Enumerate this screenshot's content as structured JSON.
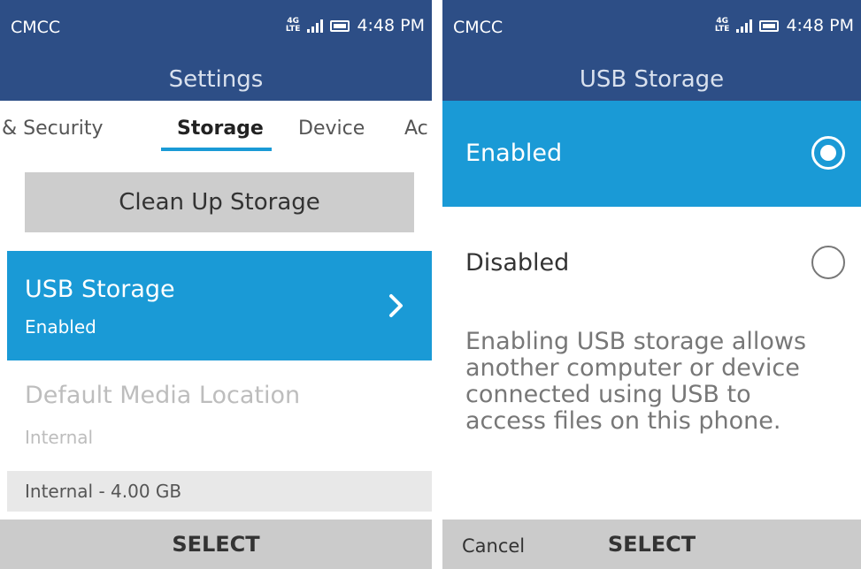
{
  "status": {
    "carrier": "CMCC",
    "network_top": "4G",
    "network_bottom": "LTE",
    "time": "4:48 PM"
  },
  "left": {
    "title": "Settings",
    "tabs": [
      "y & Security",
      "Storage",
      "Device",
      "Ac"
    ],
    "active_tab": "Storage",
    "clean_button": "Clean Up Storage",
    "usb": {
      "title": "USB Storage",
      "value": "Enabled"
    },
    "media": {
      "title": "Default Media Location",
      "value": "Internal"
    },
    "storage_info": "Internal - 4.00 GB",
    "softkey_center": "SELECT"
  },
  "right": {
    "title": "USB Storage",
    "options": [
      {
        "label": "Enabled",
        "selected": true
      },
      {
        "label": "Disabled",
        "selected": false
      }
    ],
    "description_lines": [
      "Enabling USB storage allows",
      "another computer or device",
      "connected using USB to",
      "access files on this phone."
    ],
    "softkey_left": "Cancel",
    "softkey_center": "SELECT"
  },
  "colors": {
    "header": "#2d4e86",
    "accent": "#1a9ad6",
    "softkey_bg": "#cbcbcb"
  }
}
